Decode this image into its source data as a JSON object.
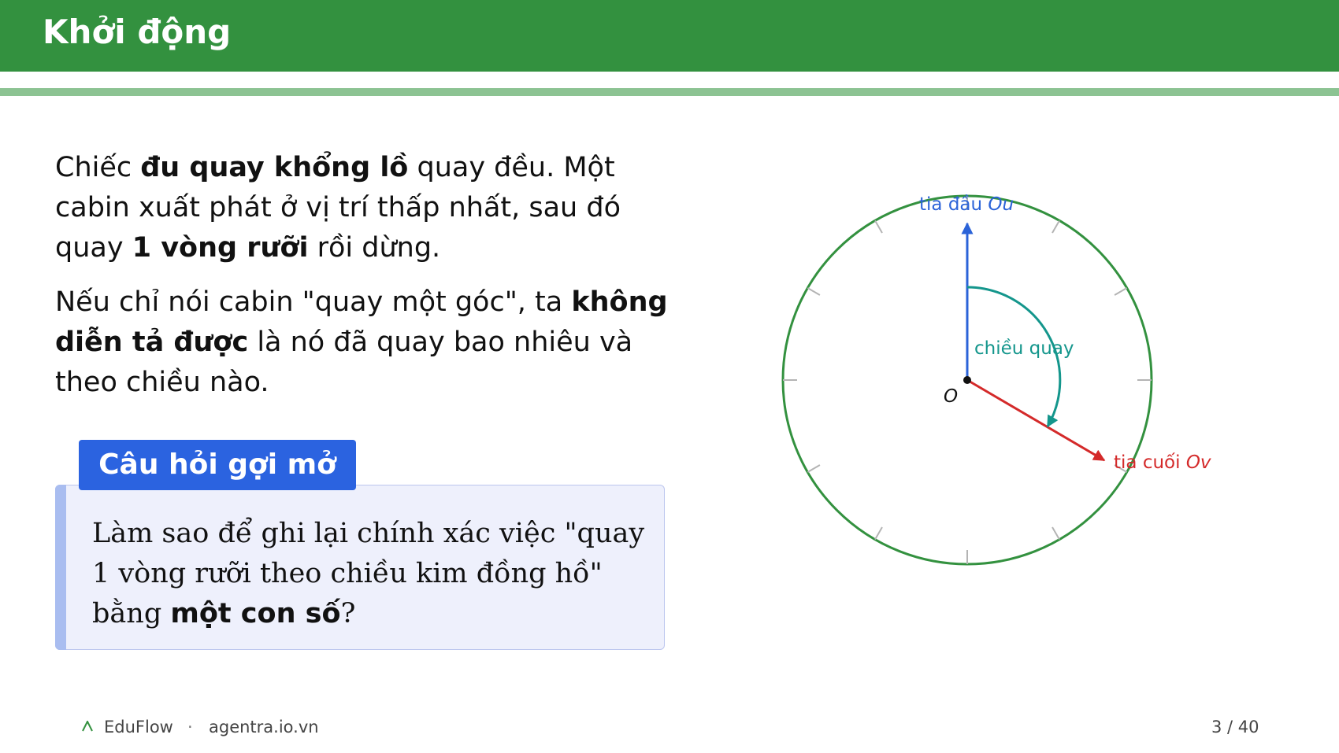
{
  "header": {
    "title": "Khởi động"
  },
  "intro": {
    "p1": [
      "Chiếc ",
      "đu quay khổng lồ",
      " quay đều. Một cabin xuất phát ở vị trí thấp nhất, sau đó quay ",
      "1 vòng rưỡi",
      " rồi dừng."
    ],
    "p2": [
      "Nếu chỉ nói cabin \"quay một góc\", ta ",
      "không diễn tả được",
      " là nó đã quay bao nhiêu và theo chiều nào."
    ]
  },
  "question_box": {
    "title": "Câu hỏi gợi mở",
    "text": [
      "Làm sao để ghi lại chính xác việc \"quay 1 vòng rưỡi theo chiều kim đồng hồ\" bằng ",
      "một con số",
      "?"
    ]
  },
  "diagram": {
    "ray_start_label": "tia đầu",
    "ray_start_var": "Ou",
    "ray_end_label": "tia cuối",
    "ray_end_var": "Ov",
    "rotation_label": "chiều quay",
    "origin_label": "O",
    "colors": {
      "circle": "#33913f",
      "ray_start": "#2b63d8",
      "ray_end": "#d42a2a",
      "rotation": "#14968c"
    }
  },
  "footer": {
    "logo_icon": "caret-logo-icon",
    "brand": "EduFlow",
    "separator": "·",
    "site": "agentra.io.vn",
    "page": "3 / 40"
  }
}
